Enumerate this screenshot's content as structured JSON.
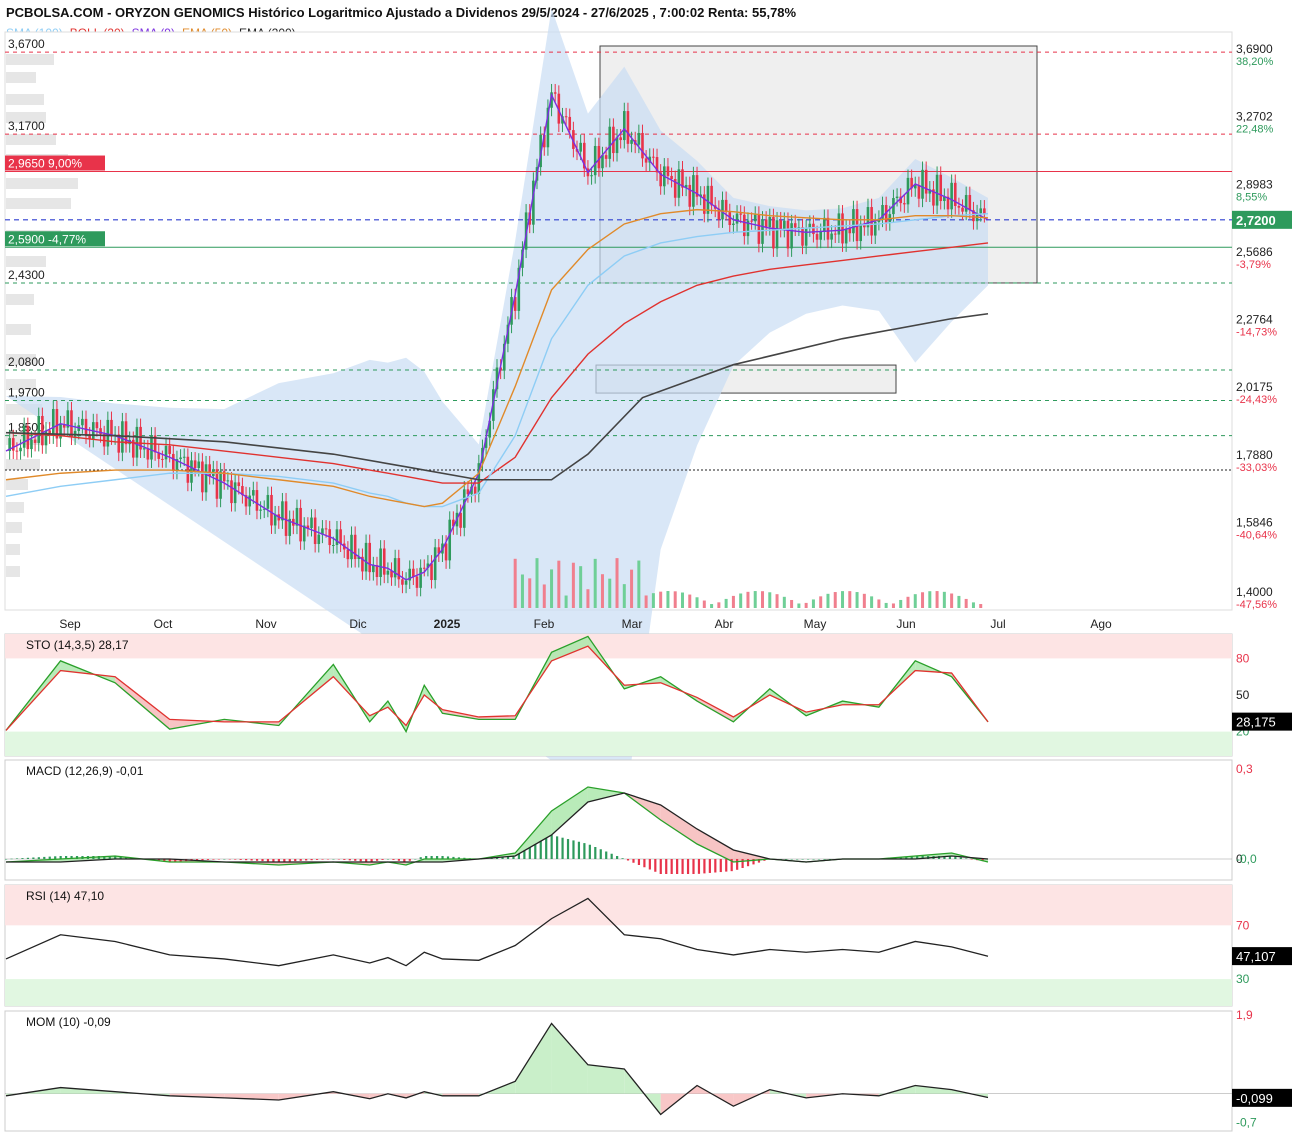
{
  "header": {
    "title": "PCBOLSA.COM - ORYZON GENOMICS Histórico Logaritmico Ajustado a Dividenos 29/5/2024 - 27/6/2025 , 7:00:02 Renta: 55,78%"
  },
  "legend": [
    {
      "label": "SMA (100)",
      "color": "#8ecdf5"
    },
    {
      "label": "BOLL (20)",
      "color": "#e0322f"
    },
    {
      "label": "SMA (9)",
      "color": "#7b2ee0"
    },
    {
      "label": "EMA (50)",
      "color": "#e08a2a"
    },
    {
      "label": "EMA (200)",
      "color": "#222222"
    }
  ],
  "colors": {
    "up": "#2e9a5c",
    "down": "#e8334a",
    "boll_fill": "#c9ddf3",
    "last_price_bg": "#2e9a5c"
  },
  "chart_data": [
    {
      "type": "line",
      "panel": "price",
      "scale": "log",
      "ylim": [
        1.36,
        3.75
      ],
      "x_labels": [
        "Sep",
        "Oct",
        "Nov",
        "Dic",
        "2025",
        "Feb",
        "Mar",
        "Abr",
        "May",
        "Jun",
        "Jul",
        "Ago"
      ],
      "x": [
        0,
        15,
        30,
        45,
        60,
        75,
        90,
        100,
        105,
        110,
        115,
        120,
        130,
        140,
        150,
        160,
        170,
        180,
        190,
        200,
        210,
        220,
        230,
        240,
        250,
        260,
        270
      ],
      "series": [
        {
          "values": [
            1.8,
            1.89,
            1.85,
            1.78,
            1.7,
            1.6,
            1.54,
            1.47,
            1.46,
            1.43,
            1.45,
            1.51,
            1.73,
            2.38,
            3.4,
            2.96,
            3.2,
            2.95,
            2.85,
            2.72,
            2.68,
            2.66,
            2.67,
            2.72,
            2.9,
            2.82,
            2.72
          ]
        },
        {
          "values": [
            1.86,
            1.85,
            1.83,
            1.82,
            1.8,
            1.78,
            1.76,
            1.74,
            1.73,
            1.72,
            1.71,
            1.7,
            1.7,
            1.78,
            1.98,
            2.14,
            2.26,
            2.35,
            2.42,
            2.46,
            2.49,
            2.51,
            2.53,
            2.55,
            2.57,
            2.59,
            2.61
          ]
        },
        {
          "values": [
            1.66,
            1.69,
            1.71,
            1.73,
            1.73,
            1.72,
            1.7,
            1.67,
            1.66,
            1.64,
            1.63,
            1.63,
            1.67,
            1.85,
            2.2,
            2.42,
            2.55,
            2.61,
            2.64,
            2.66,
            2.67,
            2.68,
            2.69,
            2.7,
            2.72,
            2.74,
            2.75
          ]
        },
        {
          "values": [
            1.71,
            1.73,
            1.74,
            1.74,
            1.73,
            1.71,
            1.69,
            1.66,
            1.65,
            1.64,
            1.63,
            1.64,
            1.73,
            2.02,
            2.4,
            2.58,
            2.7,
            2.75,
            2.77,
            2.76,
            2.74,
            2.73,
            2.72,
            2.72,
            2.74,
            2.74,
            2.73
          ]
        }
      ],
      "volume_profile": true,
      "y_ticks": [
        "3,6900",
        "3,2702",
        "2,8983",
        "2,5686",
        "2,2764",
        "2,0175",
        "1,7880",
        "1,5846",
        "1,4000"
      ],
      "pct_ticks": [
        "38,20%",
        "22,48%",
        "8,55%",
        "-3,79%",
        "-14,73%",
        "-24,43%",
        "-33,03%",
        "-40,64%",
        "-47,56%"
      ],
      "levels": [
        {
          "label": "3,6700",
          "value": 3.67,
          "color": "#e8334a",
          "style": "dashed"
        },
        {
          "label": "3,1700",
          "value": 3.17,
          "color": "#e8334a",
          "style": "dashed"
        },
        {
          "label": "2,9650",
          "pct": "9,00%",
          "value": 2.965,
          "color": "#e8334a",
          "style": "solid"
        },
        {
          "label": "2,5900",
          "pct": "-4,77%",
          "value": 2.59,
          "color": "#2e9a5c",
          "style": "solid"
        },
        {
          "label": "2,4300",
          "value": 2.43,
          "color": "#2e9a5c",
          "style": "dashed"
        },
        {
          "label": "2,0800",
          "value": 2.08,
          "color": "#2e9a5c",
          "style": "dashed"
        },
        {
          "label": "1,9700",
          "value": 1.97,
          "color": "#2e9a5c",
          "style": "dashed"
        },
        {
          "label": "1,8500",
          "value": 1.85,
          "color": "#2e9a5c",
          "style": "dashed"
        }
      ],
      "last_price": "2,7200",
      "dotted_level": 1.74
    },
    {
      "type": "line",
      "panel": "STO",
      "label": "STO (14,3,5)",
      "last": "28,17",
      "box": "28,175",
      "ylim": [
        0,
        100
      ],
      "y_ticks": [
        "80",
        "50",
        "20"
      ],
      "bands": [
        20,
        80
      ],
      "x": [
        0,
        15,
        30,
        45,
        60,
        75,
        90,
        100,
        105,
        110,
        115,
        120,
        130,
        140,
        150,
        160,
        170,
        180,
        190,
        200,
        210,
        220,
        230,
        240,
        250,
        260,
        270
      ],
      "series": [
        {
          "values": [
            21,
            78,
            60,
            22,
            30,
            25,
            75,
            28,
            45,
            20,
            58,
            35,
            30,
            30,
            85,
            98,
            55,
            65,
            45,
            28,
            55,
            33,
            45,
            40,
            78,
            65,
            28
          ]
        },
        {
          "values": [
            21,
            70,
            65,
            30,
            28,
            28,
            65,
            33,
            40,
            25,
            50,
            38,
            32,
            33,
            78,
            90,
            58,
            60,
            48,
            32,
            50,
            36,
            42,
            42,
            70,
            68,
            28
          ]
        }
      ]
    },
    {
      "type": "line",
      "panel": "MACD",
      "label": "MACD (12,26,9)",
      "last": "-0,01",
      "ylim": [
        -0.07,
        0.33
      ],
      "y_ticks": [
        "0,3",
        "0",
        "-0,0"
      ],
      "x": [
        0,
        15,
        30,
        45,
        60,
        75,
        90,
        100,
        105,
        110,
        115,
        120,
        130,
        140,
        150,
        160,
        170,
        180,
        190,
        200,
        210,
        220,
        230,
        240,
        250,
        260,
        270
      ],
      "series": [
        {
          "values": [
            -0.01,
            0.0,
            0.01,
            -0.01,
            -0.01,
            -0.02,
            -0.01,
            -0.02,
            -0.01,
            -0.02,
            0.0,
            0.0,
            0.0,
            0.02,
            0.16,
            0.24,
            0.22,
            0.13,
            0.05,
            -0.01,
            0.0,
            -0.01,
            0.0,
            0.0,
            0.01,
            0.02,
            -0.01
          ]
        },
        {
          "values": [
            -0.01,
            -0.01,
            0.0,
            0.0,
            -0.01,
            -0.01,
            -0.01,
            -0.01,
            -0.01,
            -0.01,
            -0.01,
            -0.01,
            0.0,
            0.01,
            0.08,
            0.19,
            0.22,
            0.18,
            0.1,
            0.03,
            0.0,
            -0.01,
            0.0,
            0.0,
            0.0,
            0.01,
            0.0
          ]
        }
      ]
    },
    {
      "type": "line",
      "panel": "RSI",
      "label": "RSI (14)",
      "last": "47,10",
      "box": "47,107",
      "ylim": [
        10,
        100
      ],
      "y_ticks": [
        "70",
        "30"
      ],
      "bands": [
        30,
        70
      ],
      "x": [
        0,
        15,
        30,
        45,
        60,
        75,
        90,
        100,
        105,
        110,
        115,
        120,
        130,
        140,
        150,
        160,
        170,
        180,
        190,
        200,
        210,
        220,
        230,
        240,
        250,
        260,
        270
      ],
      "series": [
        {
          "values": [
            45,
            63,
            58,
            48,
            45,
            40,
            48,
            42,
            46,
            40,
            50,
            45,
            44,
            55,
            75,
            90,
            63,
            60,
            52,
            48,
            52,
            50,
            52,
            50,
            58,
            54,
            47
          ]
        }
      ]
    },
    {
      "type": "line",
      "panel": "MOM",
      "label": "MOM (10)",
      "last": "-0,09",
      "box": "-0,099",
      "ylim": [
        -0.9,
        2.0
      ],
      "y_ticks": [
        "1,9",
        "-0,7"
      ],
      "x": [
        0,
        15,
        30,
        45,
        60,
        75,
        90,
        100,
        105,
        110,
        115,
        120,
        130,
        140,
        150,
        160,
        170,
        180,
        190,
        200,
        210,
        220,
        230,
        240,
        250,
        260,
        270
      ],
      "series": [
        {
          "values": [
            -0.05,
            0.15,
            0.05,
            -0.05,
            -0.1,
            -0.15,
            0.05,
            -0.12,
            0.0,
            -0.1,
            0.05,
            -0.05,
            -0.05,
            0.3,
            1.7,
            0.7,
            0.6,
            -0.5,
            0.2,
            -0.3,
            0.1,
            -0.1,
            0.0,
            -0.05,
            0.2,
            0.1,
            -0.09
          ]
        }
      ]
    }
  ]
}
